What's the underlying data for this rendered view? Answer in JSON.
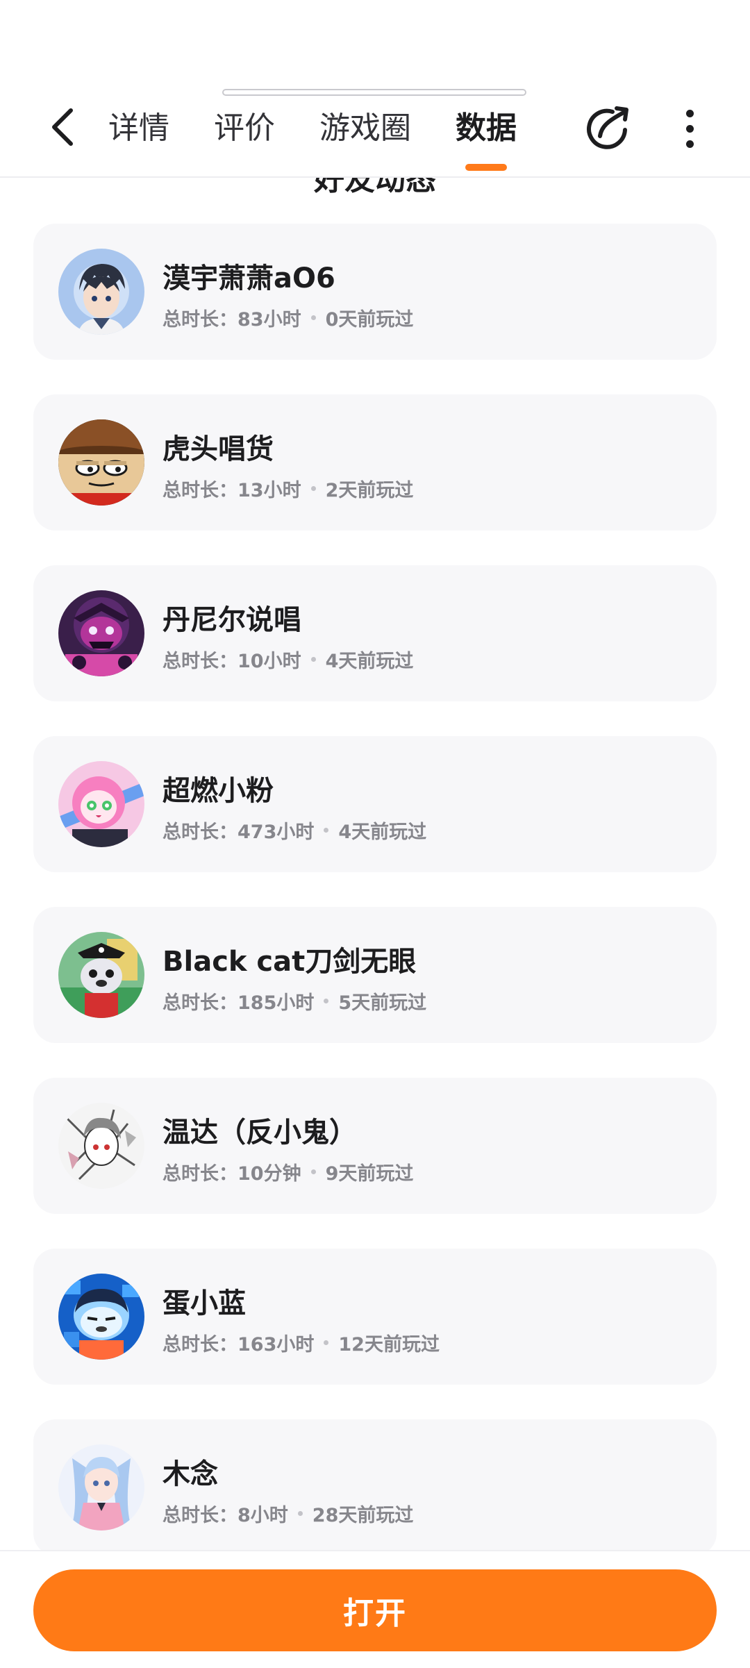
{
  "header": {
    "tabs": [
      {
        "label": "详情"
      },
      {
        "label": "评价"
      },
      {
        "label": "游戏圈"
      },
      {
        "label": "数据"
      }
    ],
    "active_tab": "数据",
    "accent_color": "#ff7a1a",
    "icons": [
      "back-icon",
      "share-icon",
      "more-icon"
    ]
  },
  "section": {
    "title": "好友动态"
  },
  "friends": [
    {
      "name": "漠宇萧萧aO6",
      "duration_label": "总时长：",
      "duration": "83小时",
      "last_played": "0天前玩过"
    },
    {
      "name": "虎头唱货",
      "duration_label": "总时长：",
      "duration": "13小时",
      "last_played": "2天前玩过"
    },
    {
      "name": "丹尼尔说唱",
      "duration_label": "总时长：",
      "duration": "10小时",
      "last_played": "4天前玩过"
    },
    {
      "name": "超燃小粉",
      "duration_label": "总时长：",
      "duration": "473小时",
      "last_played": "4天前玩过"
    },
    {
      "name": "Black cat刀剑无眼",
      "duration_label": "总时长：",
      "duration": "185小时",
      "last_played": "5天前玩过"
    },
    {
      "name": "温达（反小鬼）",
      "duration_label": "总时长：",
      "duration": "10分钟",
      "last_played": "9天前玩过"
    },
    {
      "name": "蛋小蓝",
      "duration_label": "总时长：",
      "duration": "163小时",
      "last_played": "12天前玩过"
    },
    {
      "name": "木念",
      "duration_label": "总时长：",
      "duration": "8小时",
      "last_played": "28天前玩过"
    }
  ],
  "footer": {
    "open_label": "打开",
    "button_color": "#ff7a16"
  }
}
